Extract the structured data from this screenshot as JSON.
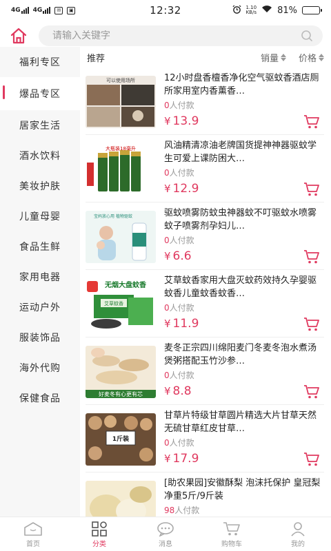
{
  "status_bar": {
    "time": "12:32",
    "signal_1": "4G",
    "signal_2": "4G",
    "net_speed": "1.10",
    "net_speed_unit": "KB/s",
    "battery": "81%",
    "battery_level": 0.81
  },
  "search": {
    "placeholder": "请输入关键字"
  },
  "sidebar": {
    "items": [
      {
        "label": "福利专区"
      },
      {
        "label": "爆品专区"
      },
      {
        "label": "居家生活"
      },
      {
        "label": "酒水饮料"
      },
      {
        "label": "美妆护肤"
      },
      {
        "label": "儿童母婴"
      },
      {
        "label": "食品生鲜"
      },
      {
        "label": "家用电器"
      },
      {
        "label": "运动户外"
      },
      {
        "label": "服装饰品"
      },
      {
        "label": "海外代购"
      },
      {
        "label": "保健食品"
      }
    ],
    "active_index": 1
  },
  "list": {
    "title": "推荐",
    "sort_sales": "销量",
    "sort_price": "价格",
    "paid_suffix": "人付款",
    "currency": "¥",
    "products": [
      {
        "name": "12小时盘香檀香净化空气驱蚊香酒店厕所家用室内香薰香…",
        "paid": "0",
        "price": "13.9"
      },
      {
        "name": "风油精清凉油老牌国货提神神器驱蚊学生可爱上课防困大…",
        "paid": "0",
        "price": "12.9"
      },
      {
        "name": "驱蚊喷雾防蚊虫神器蚊不叮驱蚊水喷雾蚊子喷雾剂孕妇儿…",
        "paid": "0",
        "price": "6.6"
      },
      {
        "name": "艾草蚊香家用大盘灭蚊药效持久孕婴驱蚊香儿童蚊香蚊香…",
        "paid": "0",
        "price": "11.9"
      },
      {
        "name": "麦冬正宗四川绵阳麦门冬麦冬泡水煮汤煲粥搭配玉竹沙参…",
        "paid": "0",
        "price": "8.8"
      },
      {
        "name": "甘草片特级甘草圆片精选大片甘草天然无硫甘草红皮甘草…",
        "paid": "0",
        "price": "17.9"
      },
      {
        "name": "[助农果园]安徽酥梨 泡沫托保护 皇冠梨 净重5斤/9斤装",
        "paid": "98",
        "price": ""
      }
    ],
    "thumb_texts": {
      "p1": "可以使用场所",
      "p2": "大瓶装18毫升",
      "p3": "宝妈放心用 植物驱蚊",
      "p4": "无烟大盘蚊香",
      "p4_box": "艾草蚊香",
      "p5": "好麦冬有心更有芯",
      "p6": "1斤装"
    }
  },
  "tabbar": {
    "items": [
      {
        "label": "首页"
      },
      {
        "label": "分类"
      },
      {
        "label": "消息"
      },
      {
        "label": "购物车"
      },
      {
        "label": "我的"
      }
    ],
    "active_index": 1
  },
  "colors": {
    "accent": "#e0395f",
    "sidebar_bg": "#f7f7f7",
    "muted": "#999999"
  }
}
